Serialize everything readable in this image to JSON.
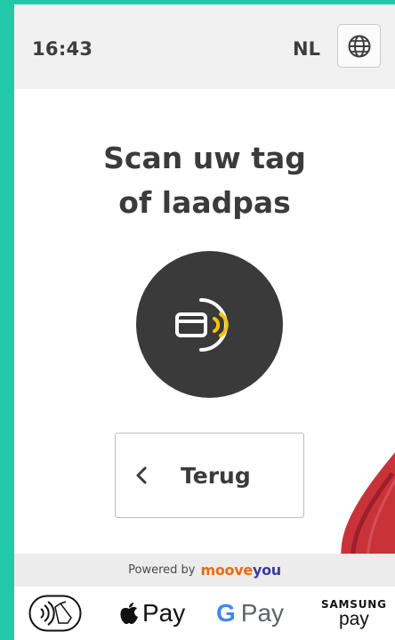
{
  "status": {
    "time": "16:43",
    "language": "NL"
  },
  "main": {
    "title_line1": "Scan uw tag",
    "title_line2": "of laadpas",
    "back_label": "Terug"
  },
  "footer": {
    "powered_by": "Powered by",
    "brand_part1": "moove",
    "brand_part2": "you"
  },
  "payments": {
    "apple_pay": "Pay",
    "google_g": "G",
    "google_pay": "Pay",
    "samsung_top": "SAMSUNG",
    "samsung_bottom": "pay"
  },
  "colors": {
    "background": "#22c9a9",
    "nfc_circle": "#3a3a3a",
    "nfc_waves": "#f5c400",
    "brand_orange": "#ec6a10",
    "brand_purple": "#3f3aa0",
    "terminal_red": "#c8333a"
  },
  "icons": [
    "globe-icon",
    "contactless-card-icon",
    "chevron-left-icon",
    "contactless-symbol-icon",
    "apple-logo-icon"
  ]
}
